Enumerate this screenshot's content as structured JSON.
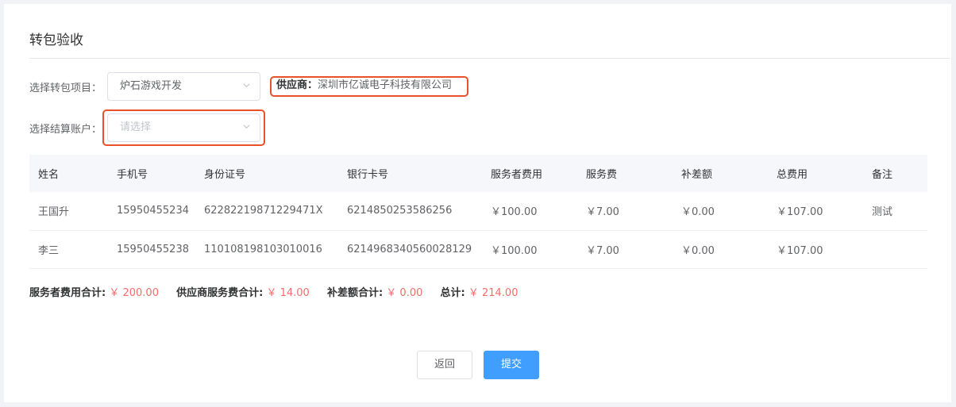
{
  "page": {
    "title": "转包验收"
  },
  "form": {
    "project_label": "选择转包项目：",
    "project_value": "炉石游戏开发",
    "supplier_label": "供应商：",
    "supplier_value": "深圳市亿诚电子科技有限公司",
    "account_label": "选择结算账户：",
    "account_placeholder": "请选择"
  },
  "table": {
    "headers": [
      "姓名",
      "手机号",
      "身份证号",
      "银行卡号",
      "服务者费用",
      "服务费",
      "补差额",
      "总费用",
      "备注"
    ],
    "rows": [
      [
        "王国升",
        "15950455234",
        "62282219871229471X",
        "6214850253586256",
        "￥100.00",
        "￥7.00",
        "￥0.00",
        "￥107.00",
        "测试"
      ],
      [
        "李三",
        "15950455238",
        "110108198103010016",
        "6214968340560028129",
        "￥100.00",
        "￥7.00",
        "￥0.00",
        "￥107.00",
        ""
      ]
    ]
  },
  "totals": {
    "provider_label": "服务者费用合计:",
    "provider_value": "￥ 200.00",
    "supplier_fee_label": "供应商服务费合计:",
    "supplier_fee_value": "￥ 14.00",
    "diff_label": "补差额合计:",
    "diff_value": "￥ 0.00",
    "total_label": "总计:",
    "total_value": "￥ 214.00"
  },
  "buttons": {
    "back": "返回",
    "submit": "提交"
  },
  "colors": {
    "accent": "#409eff",
    "highlight": "#e8512a",
    "amount": "#f56c6c"
  },
  "icons": {
    "select_arrow": "chevron-down-icon"
  }
}
